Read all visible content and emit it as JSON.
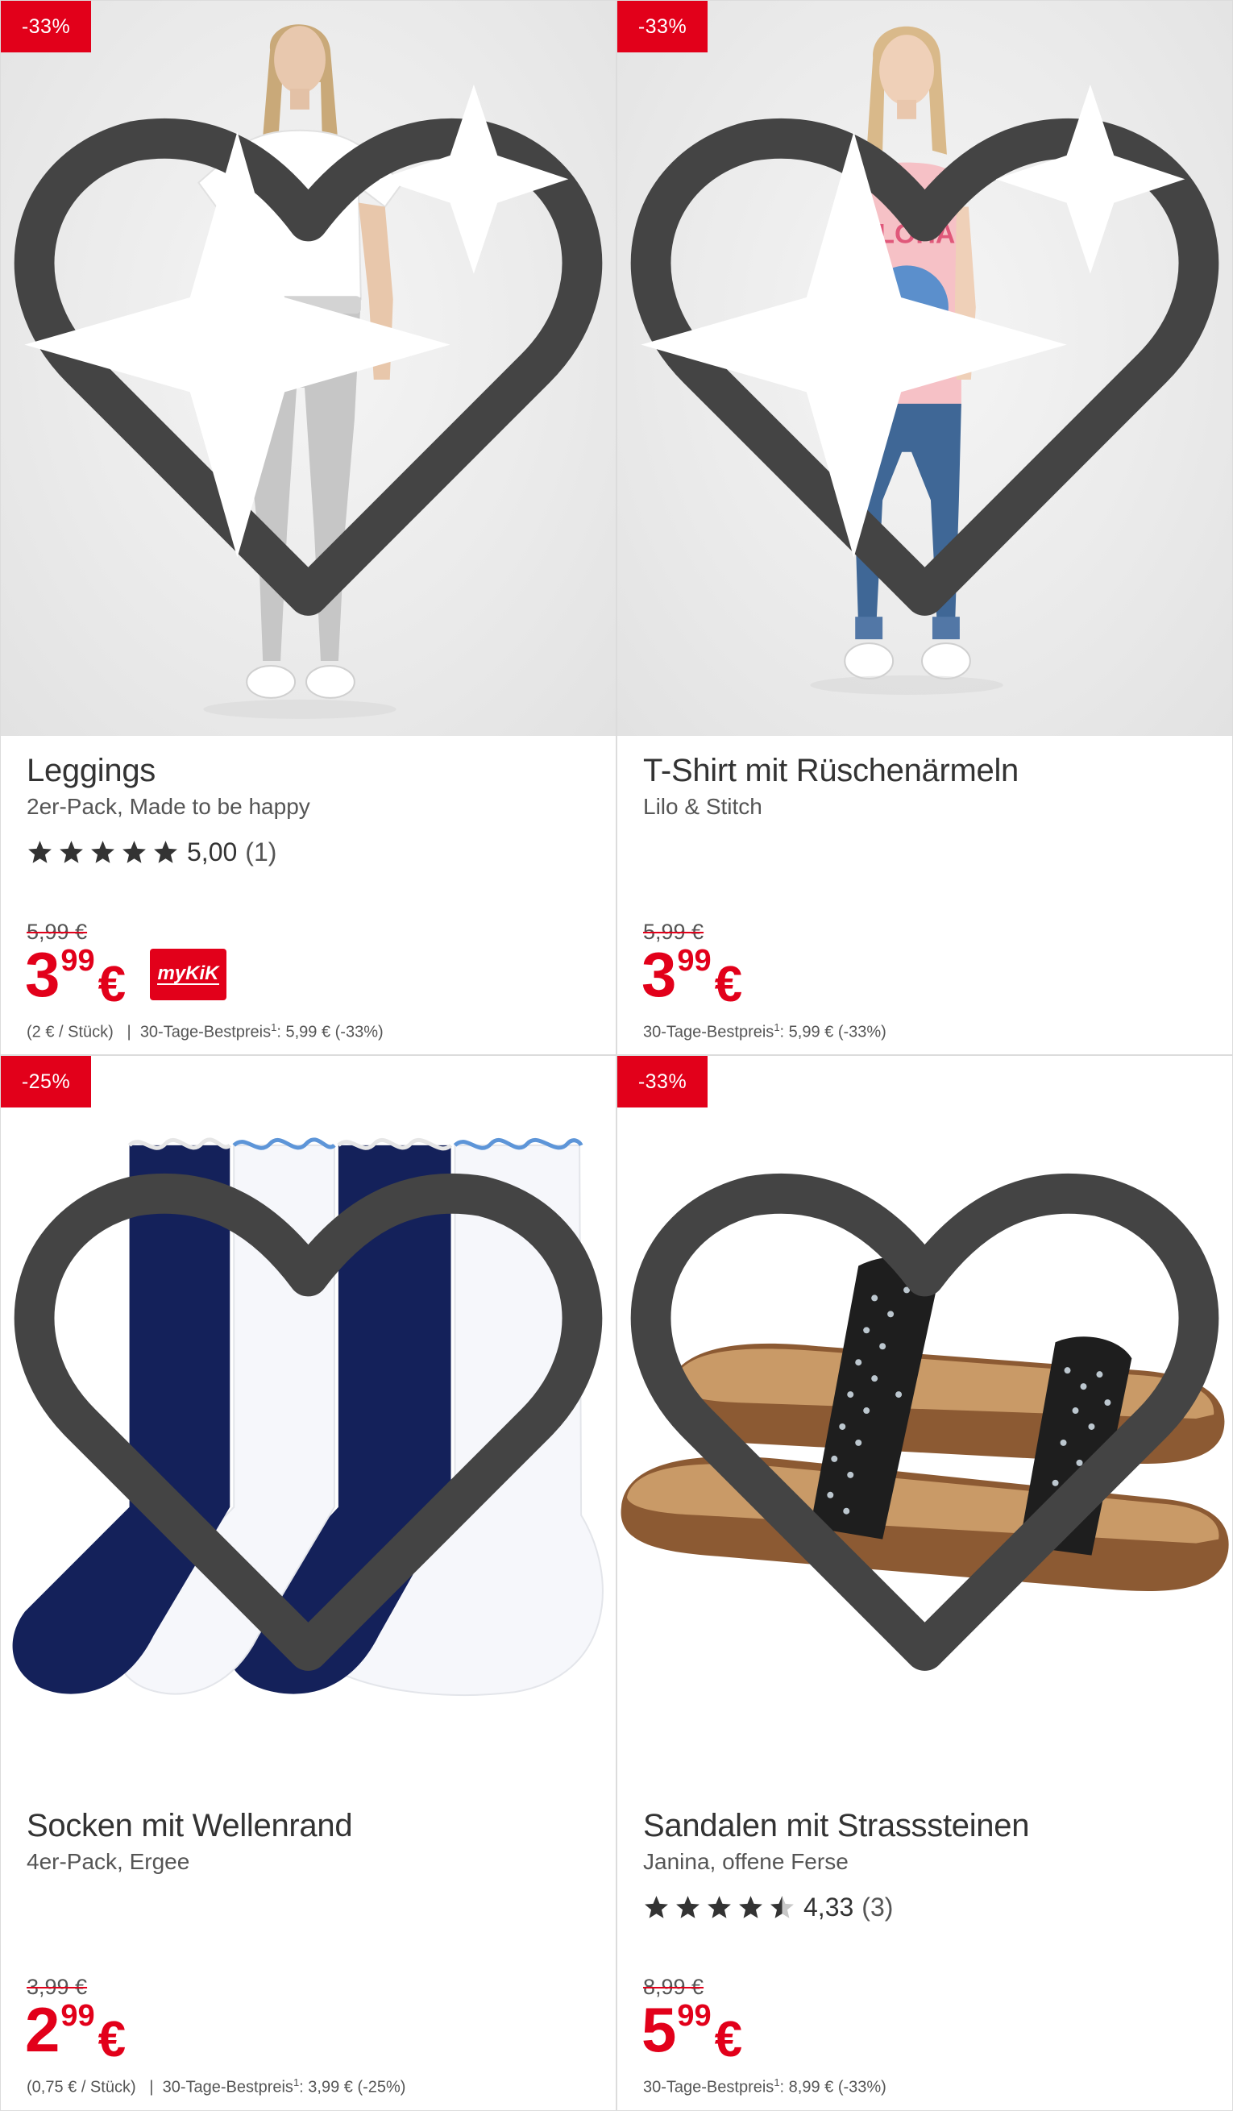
{
  "colors": {
    "accent": "#e2001a",
    "border": "#dcdcdc",
    "star": "#333333"
  },
  "products": [
    {
      "badge": "-33%",
      "title": "Leggings",
      "subtitle": "2er-Pack, Made to be happy",
      "rating": {
        "stars": 5.0,
        "score": "5,00",
        "count": "(1)"
      },
      "old_price": "5,99 €",
      "price": {
        "euros": "3",
        "cents": "99",
        "currency": "€"
      },
      "mykik_label": "myKiK",
      "unit_price": "(2 € / Stück)",
      "separator": "|",
      "ref_label": "30-Tage-Bestpreis",
      "ref_sup": "1",
      "ref_value": ": 5,99 € (-33%)"
    },
    {
      "badge": "-33%",
      "title": "T-Shirt mit Rüschenärmeln",
      "subtitle": "Lilo & Stitch",
      "old_price": "5,99 €",
      "price": {
        "euros": "3",
        "cents": "99",
        "currency": "€"
      },
      "ref_label": "30-Tage-Bestpreis",
      "ref_sup": "1",
      "ref_value": ": 5,99 € (-33%)"
    },
    {
      "badge": "-25%",
      "title": "Socken mit Wellenrand",
      "subtitle": "4er-Pack, Ergee",
      "old_price": "3,99 €",
      "price": {
        "euros": "2",
        "cents": "99",
        "currency": "€"
      },
      "unit_price": "(0,75 € / Stück)",
      "separator": "|",
      "ref_label": "30-Tage-Bestpreis",
      "ref_sup": "1",
      "ref_value": ": 3,99 € (-25%)"
    },
    {
      "badge": "-33%",
      "title": "Sandalen mit Strasssteinen",
      "subtitle": "Janina, offene Ferse",
      "rating": {
        "stars": 4.33,
        "score": "4,33",
        "count": "(3)"
      },
      "old_price": "8,99 €",
      "price": {
        "euros": "5",
        "cents": "99",
        "currency": "€"
      },
      "ref_label": "30-Tage-Bestpreis",
      "ref_sup": "1",
      "ref_value": ": 8,99 € (-33%)"
    }
  ],
  "icons": {
    "wishlist": "heart-outline-icon",
    "ai": "sparkle-icon",
    "star": "star-icon"
  }
}
